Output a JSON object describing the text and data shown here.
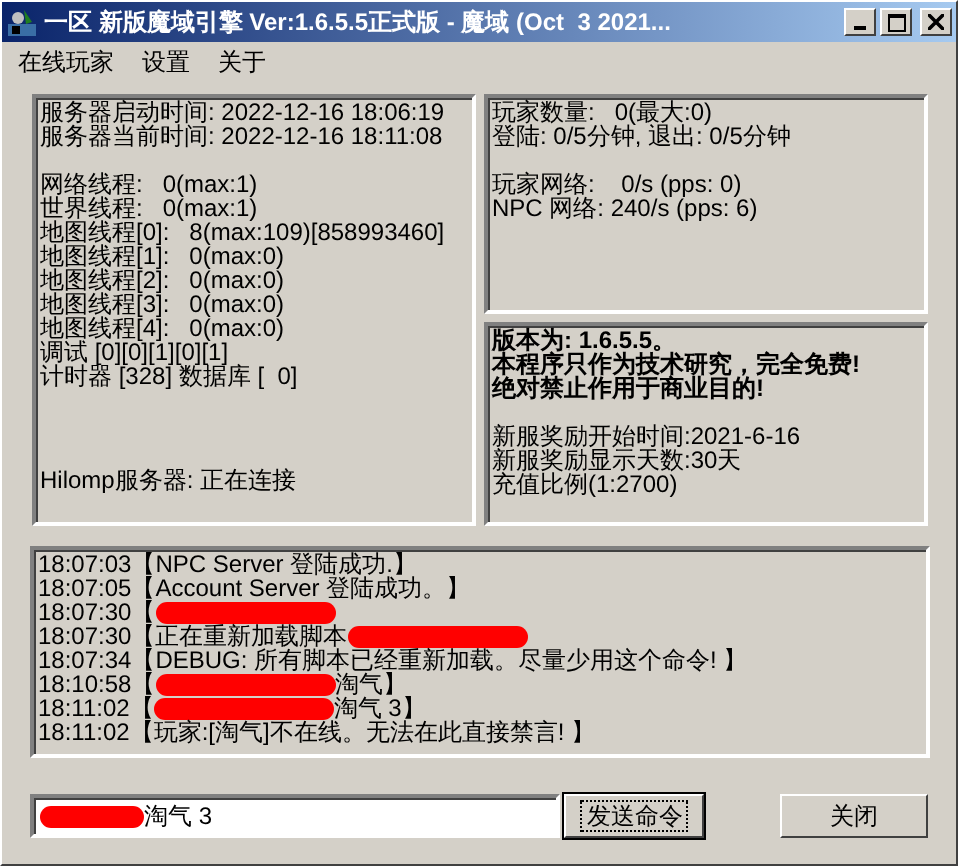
{
  "window": {
    "title": "一区 新版魔域引擎 Ver:1.6.5.5正式版 - 魔域 (Oct  3 2021...",
    "has_controls": true
  },
  "menu": [
    "在线玩家",
    "设置",
    "关于"
  ],
  "server_panel": {
    "sections": [
      {
        "bold": false,
        "lines": [
          "服务器启动时间: 2022-12-16 18:06:19",
          "服务器当前时间: 2022-12-16 18:11:08"
        ]
      },
      {
        "bold": false,
        "lines": [
          "网络线程:   0(max:1)",
          "世界线程:   0(max:1)",
          "地图线程[0]:   8(max:109)[858993460]",
          "地图线程[1]:   0(max:0)",
          "地图线程[2]:   0(max:0)",
          "地图线程[3]:   0(max:0)",
          "地图线程[4]:   0(max:0)",
          "调试 [0][0][1][0][1]",
          "计时器 [328] 数据库 [  0]"
        ]
      }
    ],
    "footer": "Hilomp服务器: 正在连接"
  },
  "player_panel": {
    "sections": [
      {
        "bold": false,
        "lines": [
          "玩家数量:   0(最大:0)",
          "登陆: 0/5分钟, 退出: 0/5分钟"
        ]
      },
      {
        "bold": false,
        "lines": [
          "玩家网络:    0/s (pps: 0)",
          "NPC 网络: 240/s (pps: 6)"
        ]
      }
    ]
  },
  "info_panel": {
    "sections": [
      {
        "bold": true,
        "lines": [
          "版本为: 1.6.5.5。",
          "本程序只作为技术研究，完全免费!",
          "绝对禁止作用于商业目的!"
        ]
      },
      {
        "bold": false,
        "lines": [
          "新服奖励开始时间:2021-6-16",
          "新服奖励显示天数:30天",
          "充值比例(1:2700)"
        ]
      }
    ]
  },
  "log": [
    {
      "time": "18:07:03",
      "parts": [
        {
          "kind": "text",
          "text": "【NPC Server 登陆成功.】"
        }
      ]
    },
    {
      "time": "18:07:05",
      "parts": [
        {
          "kind": "text",
          "text": "【Account Server 登陆成功。】"
        }
      ]
    },
    {
      "time": "18:07:30",
      "parts": [
        {
          "kind": "text",
          "text": "【"
        },
        {
          "kind": "redaction"
        }
      ]
    },
    {
      "time": "18:07:30",
      "parts": [
        {
          "kind": "text",
          "text": "【正在重新加载脚本"
        },
        {
          "kind": "redaction"
        }
      ]
    },
    {
      "time": "18:07:34",
      "parts": [
        {
          "kind": "text",
          "text": "【DEBUG: 所有脚本已经重新加载。尽量少用这个命令! 】"
        }
      ]
    },
    {
      "time": "18:10:58",
      "parts": [
        {
          "kind": "text",
          "text": "【"
        },
        {
          "kind": "redaction"
        },
        {
          "kind": "text",
          "text": "淘气】"
        }
      ]
    },
    {
      "time": "18:11:02",
      "parts": [
        {
          "kind": "text",
          "text": "【"
        },
        {
          "kind": "redaction"
        },
        {
          "kind": "text",
          "text": "淘气 3】"
        }
      ]
    },
    {
      "time": "18:11:02",
      "parts": [
        {
          "kind": "text",
          "text": "【玩家:[淘气]不在线。无法在此直接禁言! 】"
        }
      ]
    }
  ],
  "command": {
    "redacted": true,
    "value": "淘气 3"
  },
  "buttons": [
    {
      "label": "发送命令",
      "focused": true
    },
    {
      "label": "关闭",
      "focused": false
    }
  ]
}
